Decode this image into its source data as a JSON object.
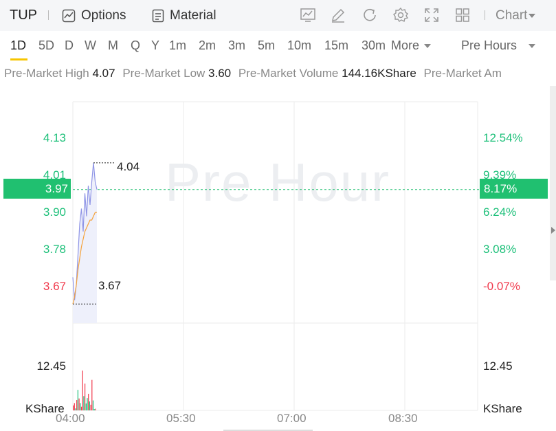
{
  "header": {
    "ticker": "TUP",
    "options_label": "Options",
    "material_label": "Material",
    "chart_label": "Chart",
    "tool_icons": [
      "chart-display-icon",
      "draw-pencil-icon",
      "refresh-icon",
      "settings-gear-icon",
      "fullscreen-icon",
      "layout-grid-icon"
    ]
  },
  "timeframes": {
    "items": [
      "1D",
      "5D",
      "D",
      "W",
      "M",
      "Q",
      "Y",
      "1m",
      "2m",
      "3m",
      "5m",
      "10m",
      "15m",
      "30m"
    ],
    "active": "1D",
    "more_label": "More",
    "session_label": "Pre Hours"
  },
  "stats": {
    "high_label": "Pre-Market High",
    "high_value": "4.07",
    "low_label": "Pre-Market Low",
    "low_value": "3.60",
    "volume_label": "Pre-Market Volume",
    "volume_value": "144.16KShare",
    "amount_label": "Pre-Market Am"
  },
  "chart": {
    "watermark": "Pre Hour",
    "current_price": "3.97",
    "current_pct": "8.17%",
    "high_marker": "4.04",
    "low_marker": "3.67",
    "volume_level": "12.45",
    "volume_unit": "KShare",
    "colors": {
      "up": "#1ec07a",
      "down": "#f0384b",
      "price_line": "#8f95e6",
      "avg_line": "#f5a23a"
    }
  },
  "chart_data": {
    "type": "line",
    "x_ticks": [
      "04:00",
      "05:30",
      "07:00",
      "08:30"
    ],
    "left_axis": [
      {
        "value": "4.13",
        "color": "green"
      },
      {
        "value": "4.01",
        "color": "green"
      },
      {
        "value": "3.90",
        "color": "green"
      },
      {
        "value": "3.78",
        "color": "green"
      },
      {
        "value": "3.67",
        "color": "red"
      }
    ],
    "right_axis": [
      {
        "value": "12.54%",
        "color": "green"
      },
      {
        "value": "9.39%",
        "color": "green"
      },
      {
        "value": "6.24%",
        "color": "green"
      },
      {
        "value": "3.08%",
        "color": "green"
      },
      {
        "value": "-0.07%",
        "color": "red"
      }
    ],
    "ylim": [
      3.62,
      4.2
    ],
    "series": [
      {
        "values": [
          3.74,
          3.68,
          3.72,
          3.8,
          3.88,
          3.92,
          3.86,
          3.96,
          3.9,
          3.98,
          3.93,
          3.99,
          4.04,
          3.99,
          3.97
        ]
      },
      {
        "values": [
          3.67,
          3.69,
          3.72,
          3.76,
          3.79,
          3.82,
          3.84,
          3.86,
          3.87,
          3.88,
          3.89,
          3.89,
          3.9,
          3.91,
          3.91
        ]
      }
    ],
    "volume": {
      "values": [
        1.5,
        2.2,
        0.6,
        3.1,
        6.2,
        3.6,
        2.2,
        1.1,
        12.0,
        4.3,
        8.1,
        2.1,
        3.7,
        5.0,
        2.7,
        1.7,
        9.2,
        3.0,
        0.4,
        0.5
      ],
      "colors": [
        "red",
        "red",
        "green",
        "red",
        "green",
        "red",
        "green",
        "red",
        "red",
        "green",
        "red",
        "green",
        "green",
        "red",
        "green",
        "red",
        "red",
        "green",
        "green",
        "red"
      ]
    }
  }
}
